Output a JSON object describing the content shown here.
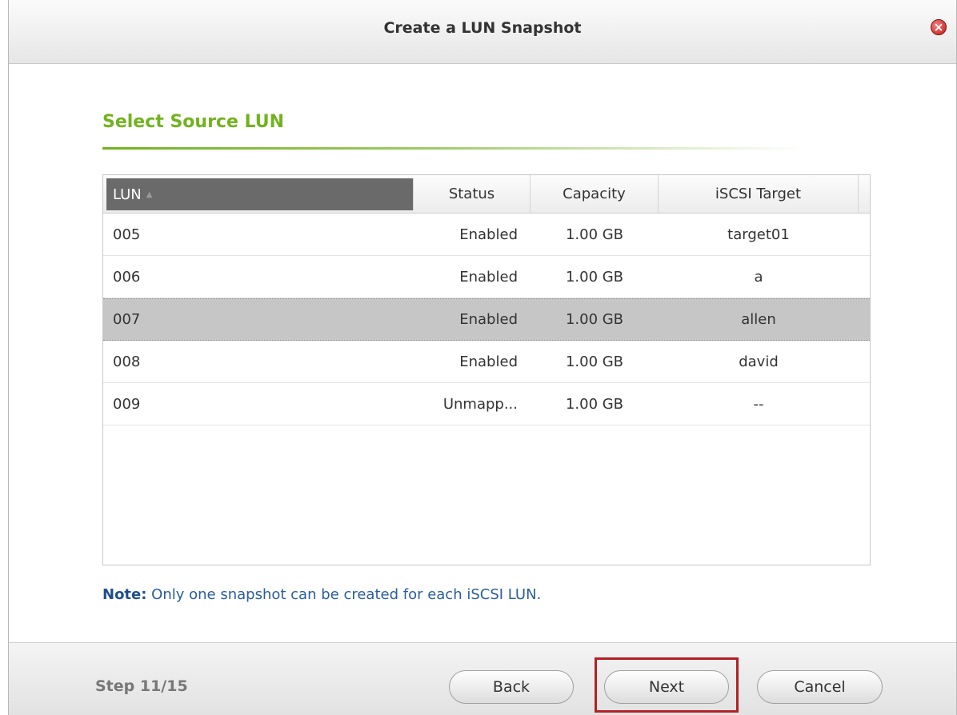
{
  "dialog": {
    "title": "Create a LUN Snapshot",
    "close_icon": "close-icon"
  },
  "section": {
    "title": "Select Source LUN"
  },
  "table": {
    "columns": [
      "LUN",
      "Status",
      "Capacity",
      "iSCSI Target"
    ],
    "sort_indicator": "▲",
    "rows": [
      {
        "lun": "005",
        "status": "Enabled",
        "capacity": "1.00 GB",
        "target": "target01"
      },
      {
        "lun": "006",
        "status": "Enabled",
        "capacity": "1.00 GB",
        "target": "a"
      },
      {
        "lun": "007",
        "status": "Enabled",
        "capacity": "1.00 GB",
        "target": "allen"
      },
      {
        "lun": "008",
        "status": "Enabled",
        "capacity": "1.00 GB",
        "target": "david"
      },
      {
        "lun": "009",
        "status": "Unmapp...",
        "capacity": "1.00 GB",
        "target": "--"
      }
    ],
    "selected_row": "007"
  },
  "note": {
    "label": "Note:",
    "text": " Only one snapshot can be created for each iSCSI LUN."
  },
  "footer": {
    "step": "Step 11/15",
    "back_label": "Back",
    "next_label": "Next",
    "cancel_label": "Cancel"
  },
  "colors": {
    "accent_green": "#73b21f",
    "note_blue": "#2a5d9f",
    "highlight_red": "#b32025",
    "selected_row": "#c6c6c6"
  }
}
